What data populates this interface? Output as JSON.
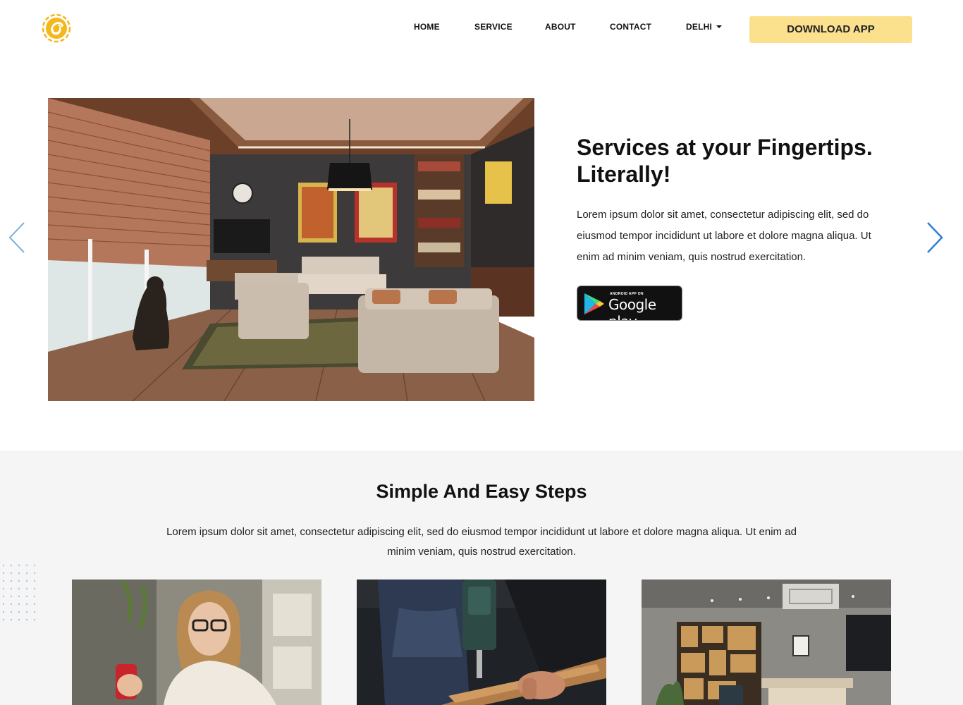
{
  "header": {
    "logo_icon": "eagle-logo-icon",
    "nav": [
      {
        "label": "HOME"
      },
      {
        "label": "SERVICE"
      },
      {
        "label": "ABOUT"
      },
      {
        "label": "CONTACT"
      },
      {
        "label": "DELHI"
      }
    ],
    "download_label": "DOWNLOAD APP"
  },
  "hero": {
    "image_icon": "living-room-photo",
    "title": "Services at your Fingertips. Literally!",
    "text": "Lorem ipsum dolor sit amet, consectetur adipiscing elit, sed do eiusmod tempor incididunt ut labore et dolore magna aliqua. Ut enim ad minim veniam, quis nostrud exercitation.",
    "store_badge": {
      "small": "ANDROID APP ON",
      "big": "Google play"
    }
  },
  "steps": {
    "title": "Simple And Easy Steps",
    "text": "Lorem ipsum dolor sit amet, consectetur adipiscing elit, sed do eiusmod tempor incididunt ut labore et dolore magna aliqua. Ut enim ad minim veniam, quis nostrud exercitation.",
    "cards": [
      {
        "icon": "woman-with-phone-photo"
      },
      {
        "icon": "drill-worker-photo"
      },
      {
        "icon": "office-interior-photo"
      }
    ]
  },
  "colors": {
    "accent": "#fbe08e",
    "arrow": "#2f7fd6",
    "section_bg": "#f5f5f5"
  }
}
